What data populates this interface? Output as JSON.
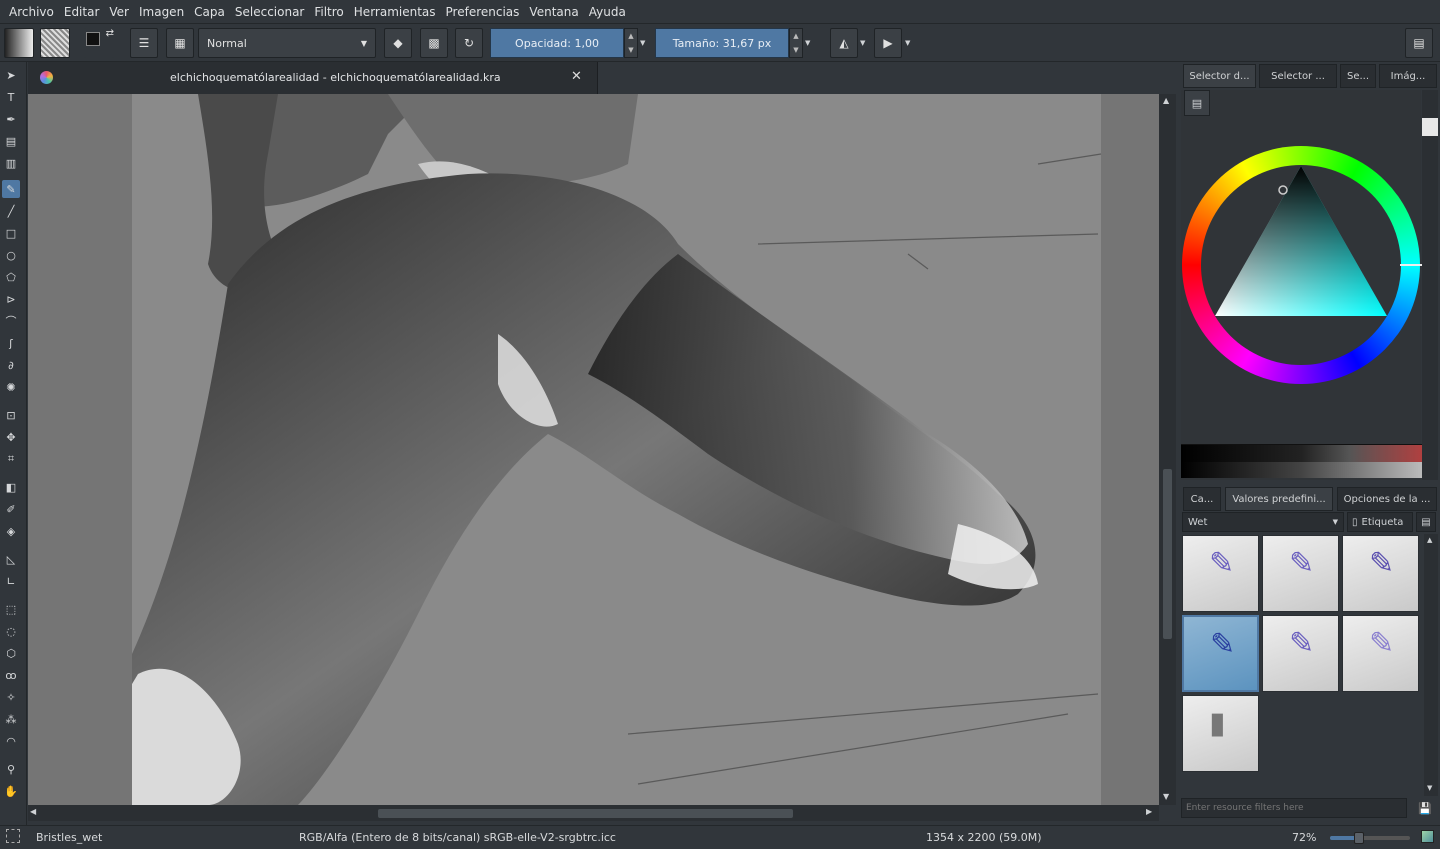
{
  "menu": [
    "Archivo",
    "Editar",
    "Ver",
    "Imagen",
    "Capa",
    "Seleccionar",
    "Filtro",
    "Herramientas",
    "Preferencias",
    "Ventana",
    "Ayuda"
  ],
  "toolbar": {
    "blend_mode": "Normal",
    "opacity_label": "Opacidad:",
    "opacity_value": "1,00",
    "size_label": "Tamaño:",
    "size_value": "31,67 px"
  },
  "document": {
    "tab_title": "elchichoquematólarealidad - elchichoquematólarealidad.kra"
  },
  "right_panel": {
    "top_tabs": [
      "Selector d...",
      "Selector ...",
      "Se...",
      "Imág..."
    ],
    "bottom_tabs": [
      "Ca...",
      "Valores predefini...",
      "Opciones de la ..."
    ],
    "preset_filter": "Wet",
    "tag_button": "Etiqueta",
    "filter_placeholder": "Enter resource filters here",
    "accent": "#4f78a3"
  },
  "status": {
    "brush": "Bristles_wet",
    "color_info": "RGB/Alfa (Entero de 8 bits/canal)  sRGB-elle-V2-srgbtrc.icc",
    "dimensions": "1354 x 2200 (59.0M)",
    "zoom": "72%"
  }
}
